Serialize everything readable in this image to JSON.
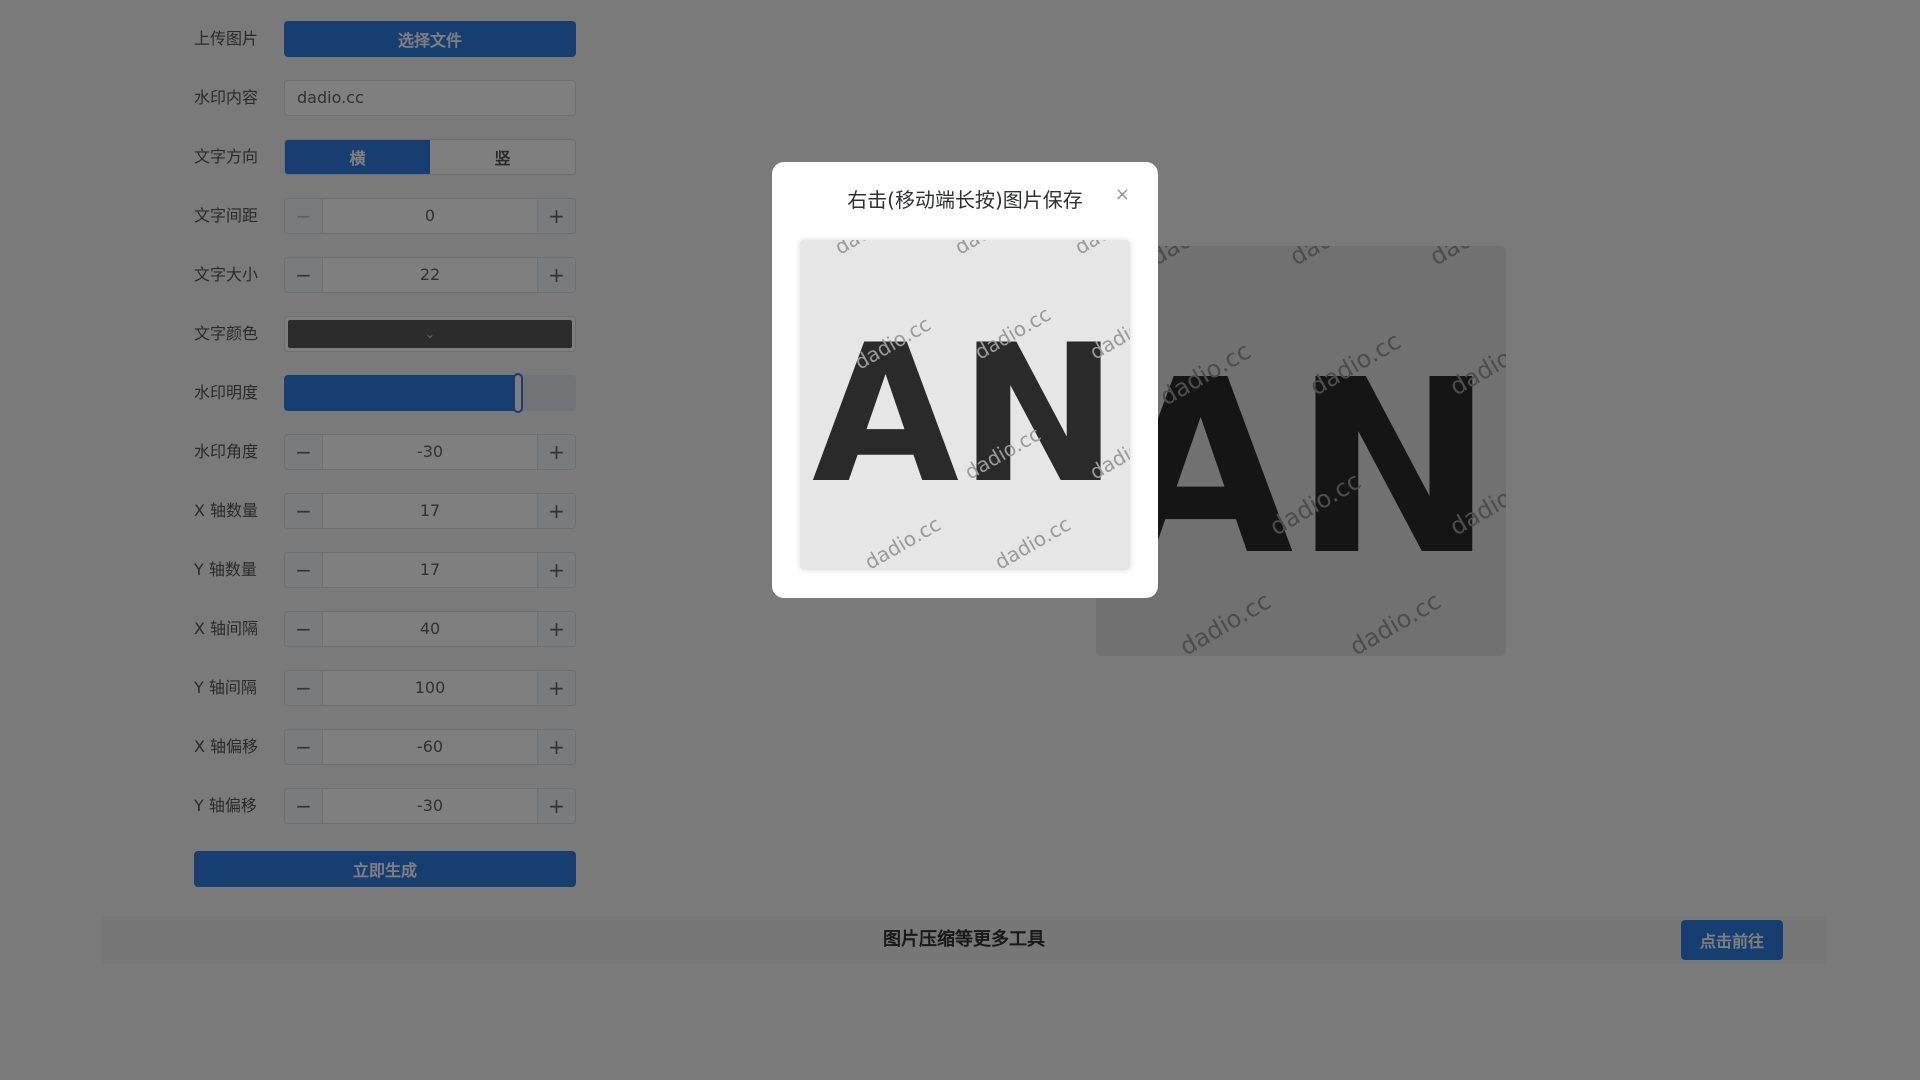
{
  "form": {
    "upload_label": "上传图片",
    "upload_button": "选择文件",
    "watermark_label": "水印内容",
    "watermark_value": "dadio.cc",
    "direction_label": "文字方向",
    "direction_options": [
      "横",
      "竖"
    ],
    "spacing_label": "文字间距",
    "spacing_value": "0",
    "size_label": "文字大小",
    "size_value": "22",
    "color_label": "文字颜色",
    "color_value": "#595959",
    "opacity_label": "水印明度",
    "opacity_fraction": 0.8,
    "angle_label": "水印角度",
    "angle_value": "-30",
    "x_count_label": "X 轴数量",
    "x_count_value": "17",
    "y_count_label": "Y 轴数量",
    "y_count_value": "17",
    "x_gap_label": "X 轴间隔",
    "x_gap_value": "40",
    "y_gap_label": "Y 轴间隔",
    "y_gap_value": "100",
    "x_offset_label": "X 轴偏移",
    "x_offset_value": "-60",
    "y_offset_label": "Y 轴偏移",
    "y_offset_value": "-30",
    "generate_button": "立即生成"
  },
  "tools": {
    "text": "图片压缩等更多工具",
    "button": "点击前往"
  },
  "dialog": {
    "title": "右击(移动端长按)图片保存",
    "close": "×"
  },
  "image": {
    "letters": "AN",
    "watermark": "dadio.cc"
  },
  "colors": {
    "accent": "#2f7de1",
    "background": "#f5f5f5"
  }
}
